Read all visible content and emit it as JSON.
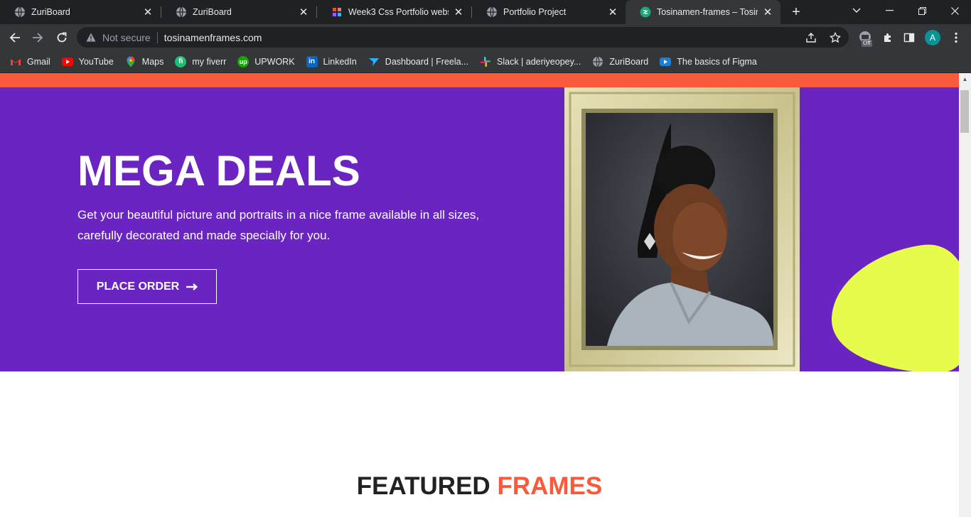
{
  "browser": {
    "tabs": [
      {
        "title": "ZuriBoard",
        "icon": "globe-icon",
        "active": false
      },
      {
        "title": "ZuriBoard",
        "icon": "globe-icon",
        "active": false
      },
      {
        "title": "Week3 Css Portfolio website",
        "icon": "figma-dots-icon",
        "active": false
      },
      {
        "title": "Portfolio Project",
        "icon": "globe-icon",
        "active": false
      },
      {
        "title": "Tosinamen-frames – Tosinam",
        "icon": "site-icon",
        "active": true
      }
    ],
    "address": {
      "security_label": "Not secure",
      "url": "tosinamenframes.com"
    },
    "profile_initial": "A",
    "extension_badge": "Off",
    "bookmarks": [
      {
        "label": "Gmail",
        "icon": "gmail-icon"
      },
      {
        "label": "YouTube",
        "icon": "youtube-icon"
      },
      {
        "label": "Maps",
        "icon": "maps-icon"
      },
      {
        "label": "my fiverr",
        "icon": "fiverr-icon"
      },
      {
        "label": "UPWORK",
        "icon": "upwork-icon"
      },
      {
        "label": "LinkedIn",
        "icon": "linkedin-icon"
      },
      {
        "label": "Dashboard | Freela...",
        "icon": "freelancer-icon"
      },
      {
        "label": "Slack | aderiyeopey...",
        "icon": "slack-icon"
      },
      {
        "label": "ZuriBoard",
        "icon": "globe-icon"
      },
      {
        "label": "The basics of Figma",
        "icon": "video-icon"
      }
    ]
  },
  "page": {
    "hero": {
      "title": "MEGA DEALS",
      "text": "Get your beautiful picture and portraits in a nice frame available in all sizes, carefully decorated and made specially for you.",
      "button_label": "PLACE ORDER",
      "button_icon": "arrow-right-icon"
    },
    "featured": {
      "heading_main": "FEATURED",
      "heading_accent": "FRAMES"
    }
  },
  "colors": {
    "accent": "#fa5a3c",
    "hero_bg": "#6a24c2",
    "blob": "#e6fb4c"
  }
}
